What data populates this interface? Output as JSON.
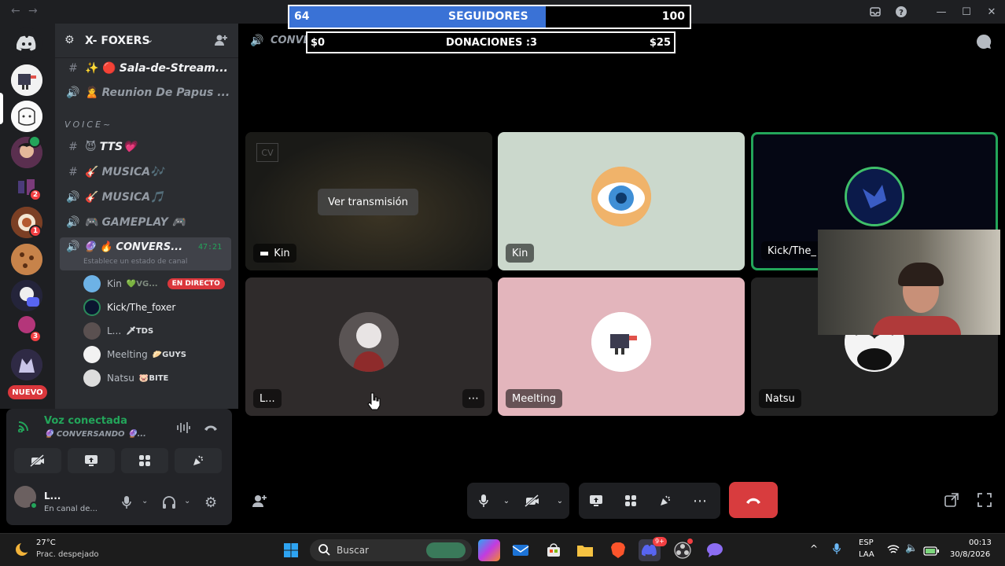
{
  "window": {
    "back_glyph": "←",
    "forward_glyph": "→",
    "min_glyph": "—",
    "max_glyph": "☐",
    "close_glyph": "✕"
  },
  "overlay": {
    "followers_current": "64",
    "followers_label": "SEGUIDORES",
    "followers_goal": "100",
    "followers_progress": 0.64,
    "donations_current": "$0",
    "donations_label": "DONACIONES :3",
    "donations_goal": "$25"
  },
  "header": {
    "channel_name": "CONVERSANDO"
  },
  "server": {
    "name": "X- FOXERS"
  },
  "rail": {
    "new_badge": "NUEVO",
    "badges": [
      "2",
      "1",
      "3"
    ]
  },
  "channels": {
    "items": [
      {
        "icon": "#",
        "emoji": "✨ 🔴",
        "label": "Sala-de-Stream..."
      },
      {
        "icon": "🔊",
        "emoji": "🙎",
        "label": "Reunion De Papus ..."
      }
    ],
    "voice_category": "VOICE~",
    "voice_items": [
      {
        "icon": "#",
        "emoji": "😈",
        "label": "TTS💗"
      },
      {
        "icon": "#",
        "emoji": "🎸",
        "label": "MUSICA🎶"
      },
      {
        "icon": "🔊",
        "emoji": "🎸",
        "label": "MUSICA🎵"
      },
      {
        "icon": "🔊",
        "emoji": "🎮",
        "label": "GAMEPLAY 🎮"
      }
    ],
    "active": {
      "label": "🔮 🔥 CONVERS...",
      "time": "47:21",
      "status_hint": "Establece un estado de canal"
    }
  },
  "voice_users": [
    {
      "name": "Kin",
      "tag": "💚VG...",
      "live": "EN DIRECTO"
    },
    {
      "name": "Kick/The_foxer",
      "tag": ""
    },
    {
      "name": "L...",
      "tag": "🗡TDS"
    },
    {
      "name": "Meelting",
      "tag": "🥟GUYS"
    },
    {
      "name": "Natsu",
      "tag": "🐷BITE"
    }
  ],
  "panel": {
    "status": "Voz conectada",
    "channel": "🔮 CONVERSANDO 🔮...",
    "username": "L...",
    "substatus": "En canal de..."
  },
  "tiles": [
    {
      "name": "Kin",
      "overlay_button": "Ver transmisión",
      "bg": "#1a1a17"
    },
    {
      "name": "Kin",
      "bg": "#cbd8cc"
    },
    {
      "name": "Kick/The_",
      "bg": "#050714"
    },
    {
      "name": "L...",
      "bg": "#2f2b2b"
    },
    {
      "name": "Meelting",
      "bg": "#e3b5bc"
    },
    {
      "name": "Natsu",
      "bg": "#232323"
    }
  ],
  "taskbar": {
    "weather_temp": "27°C",
    "weather_desc": "Prac. despejado",
    "search_placeholder": "Buscar",
    "lang_top": "ESP",
    "lang_bottom": "LAA",
    "time": "00:13",
    "date": "30/8/2026",
    "discord_badge": "9+"
  },
  "colors": {
    "accent_blue": "#3a72d6",
    "live_red": "#da373c",
    "speaking_green": "#23a55a",
    "hangup_red": "#d83c3e"
  }
}
